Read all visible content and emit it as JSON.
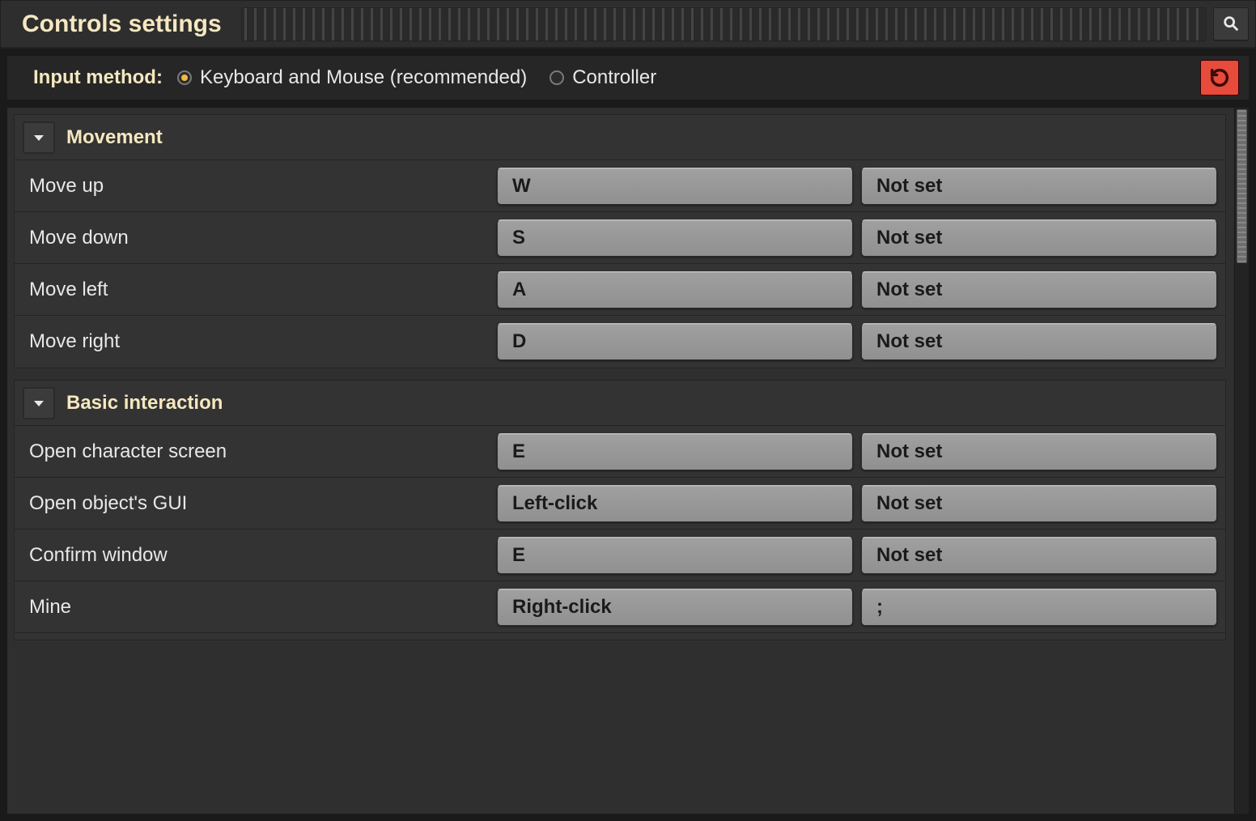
{
  "title": "Controls settings",
  "input_method": {
    "label": "Input method:",
    "options": [
      {
        "label": "Keyboard and Mouse (recommended)",
        "selected": true
      },
      {
        "label": "Controller",
        "selected": false
      }
    ]
  },
  "not_set_label": "Not set",
  "sections": [
    {
      "title": "Movement",
      "bindings": [
        {
          "label": "Move up",
          "primary": "W",
          "secondary": "Not set"
        },
        {
          "label": "Move down",
          "primary": "S",
          "secondary": "Not set"
        },
        {
          "label": "Move left",
          "primary": "A",
          "secondary": "Not set"
        },
        {
          "label": "Move right",
          "primary": "D",
          "secondary": "Not set"
        }
      ]
    },
    {
      "title": "Basic interaction",
      "bindings": [
        {
          "label": "Open character screen",
          "primary": "E",
          "secondary": "Not set"
        },
        {
          "label": "Open object's GUI",
          "primary": "Left-click",
          "secondary": "Not set"
        },
        {
          "label": "Confirm window",
          "primary": "E",
          "secondary": "Not set"
        },
        {
          "label": "Mine",
          "primary": "Right-click",
          "secondary": ";"
        }
      ]
    }
  ]
}
